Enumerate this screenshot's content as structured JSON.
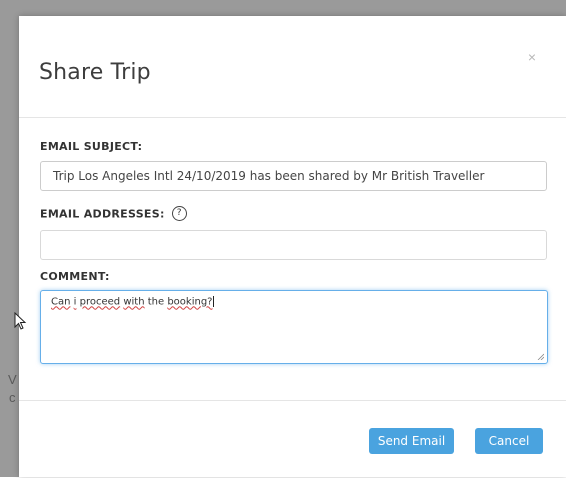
{
  "dialog": {
    "title": "Share Trip",
    "close_label": "×"
  },
  "fields": {
    "subject": {
      "label": "EMAIL SUBJECT:",
      "value": "Trip Los Angeles Intl 24/10/2019 has been shared by Mr British Traveller"
    },
    "addresses": {
      "label": "EMAIL ADDRESSES:",
      "help_glyph": "?",
      "value": ""
    },
    "comment": {
      "label": "COMMENT:",
      "words": [
        "Can",
        "i",
        "proceed",
        "with",
        "the",
        "booking?"
      ]
    }
  },
  "buttons": {
    "send": "Send Email",
    "cancel": "Cancel"
  },
  "background": {
    "fragments": [
      "V",
      "c"
    ]
  },
  "colors": {
    "primary_button": "#4aa3df",
    "focus_border": "#66afe9",
    "backdrop": "#9a9a9a"
  }
}
